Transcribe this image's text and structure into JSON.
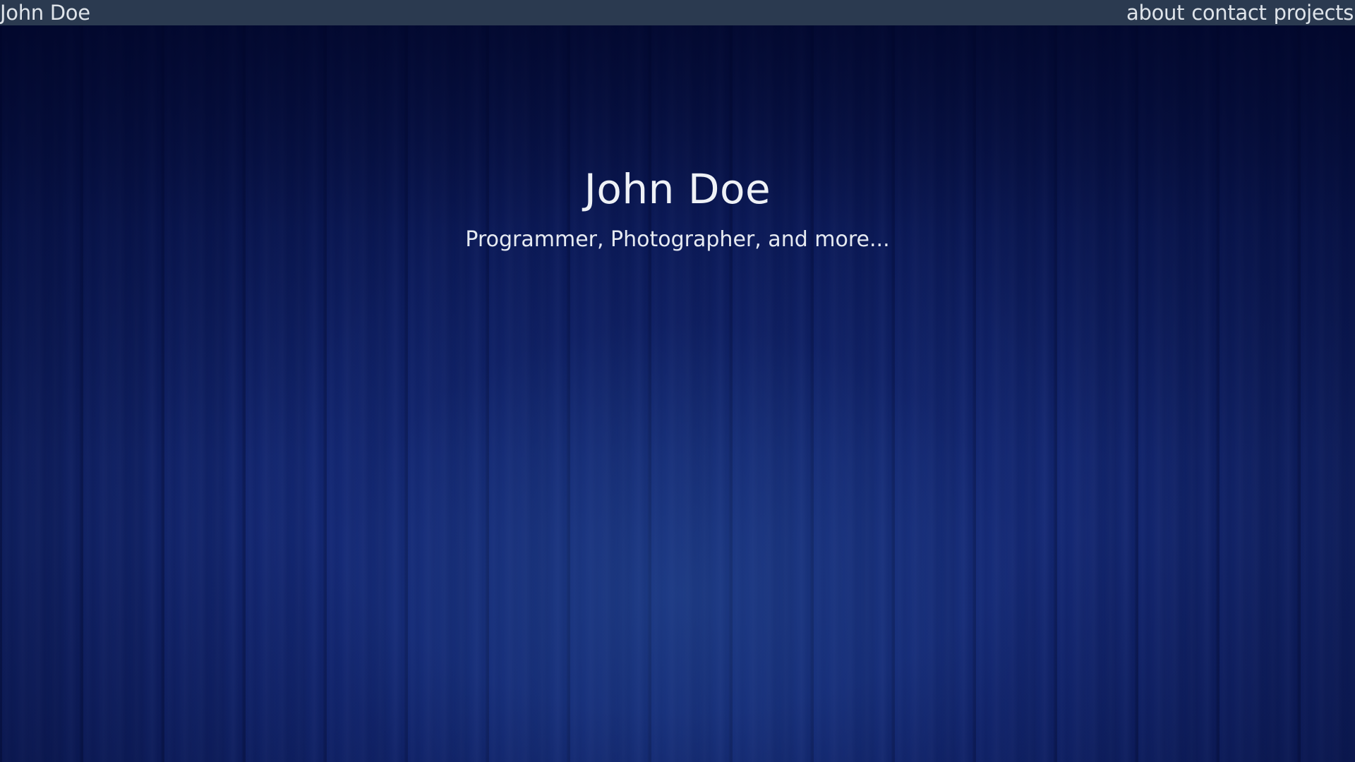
{
  "header": {
    "brand": "John Doe",
    "nav": [
      {
        "label": "about"
      },
      {
        "label": "contact"
      },
      {
        "label": "projects"
      }
    ]
  },
  "hero": {
    "title": "John Doe",
    "subtitle": "Programmer, Photographer, and more..."
  },
  "colors": {
    "topbar": "#2b3a50",
    "background": "#0f1f5c",
    "text": "#eef1f6"
  }
}
